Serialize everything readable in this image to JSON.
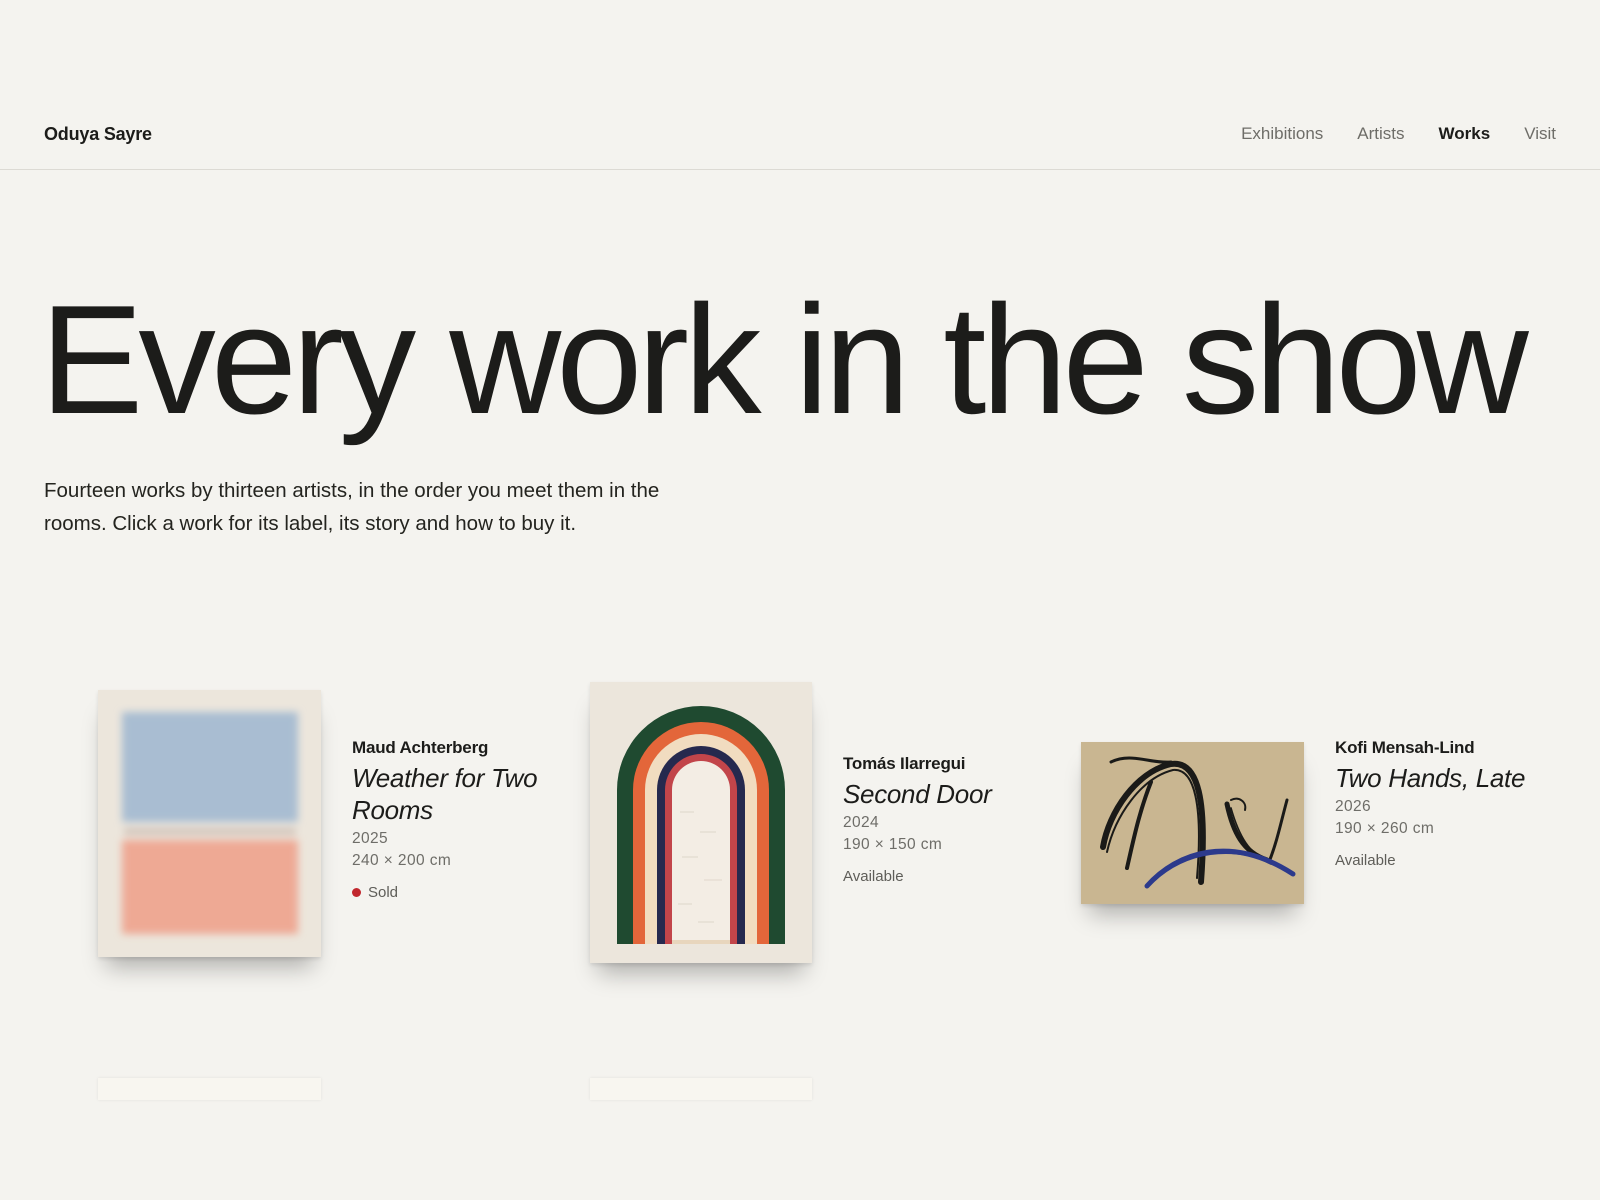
{
  "header": {
    "brand": "Oduya Sayre",
    "nav": [
      "Exhibitions",
      "Artists",
      "Works",
      "Visit"
    ],
    "active_nav": "Works"
  },
  "hero": {
    "title": "Every work in the show",
    "subtitle": "Fourteen works by thirteen artists, in the order you meet them in the rooms. Click a work for its label, its story and how to buy it."
  },
  "works": [
    {
      "artist": "Maud Achterberg",
      "title": "Weather for Two Rooms",
      "year": "2025",
      "dimensions": "240 × 200 cm",
      "status": "Sold",
      "sold": true,
      "colors": {
        "ground": "#ece6dc",
        "top": "#a9bdd2",
        "bottom": "#eea994"
      }
    },
    {
      "artist": "Tomás Ilarregui",
      "title": "Second Door",
      "year": "2024",
      "dimensions": "190 × 150 cm",
      "status": "Available",
      "sold": false,
      "colors": {
        "green": "#1f4a30",
        "orange": "#e3663a",
        "cream": "#f1dcc0",
        "navy": "#26294e",
        "red": "#c2454a"
      }
    },
    {
      "artist": "Kofi Mensah-Lind",
      "title": "Two Hands, Late",
      "year": "2026",
      "dimensions": "190 × 260 cm",
      "status": "Available",
      "sold": false,
      "colors": {
        "ground": "#c9b691",
        "ink": "#1a1a18",
        "blue": "#2c3a8c"
      }
    }
  ],
  "colors": {
    "background": "#f4f3ef",
    "text": "#1c1c1a",
    "muted": "#6e6d68",
    "sold": "#c1272d"
  }
}
